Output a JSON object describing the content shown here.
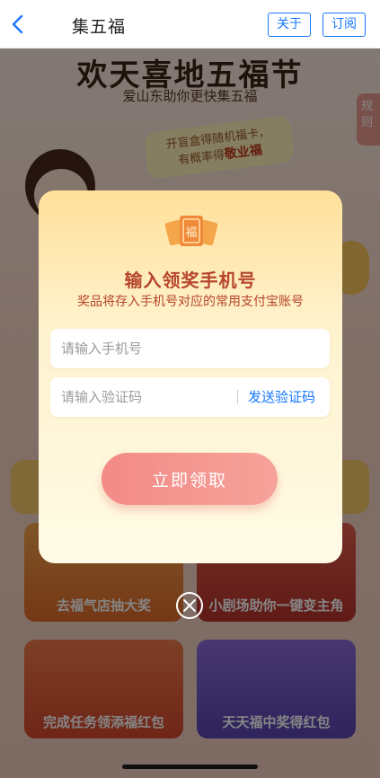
{
  "nav": {
    "title": "集五福",
    "about_label": "关于",
    "subscribe_label": "订阅"
  },
  "background": {
    "headline": "欢天喜地五福节",
    "subline": "爱山东助你更快集五福",
    "rules_label": "规则",
    "bubble_line1": "开盲盒得随机福卡，",
    "bubble_line2_prefix": "有概率得",
    "bubble_highlight": "敬业福",
    "cards": [
      {
        "label": "去福气店抽大奖"
      },
      {
        "label": "小剧场助你一键变主角"
      },
      {
        "label": "完成任务领添福红包"
      },
      {
        "label": "天天福中奖得红包"
      }
    ]
  },
  "modal": {
    "title": "输入领奖手机号",
    "subtitle": "奖品将存入手机号对应的常用支付宝账号",
    "phone_placeholder": "请输入手机号",
    "phone_value": "",
    "code_placeholder": "请输入验证码",
    "code_value": "",
    "send_code_label": "发送验证码",
    "claim_label": "立即领取"
  },
  "colors": {
    "accent": "#1677ff",
    "modal_title": "#b5452c",
    "claim_button": "#f38a86"
  }
}
